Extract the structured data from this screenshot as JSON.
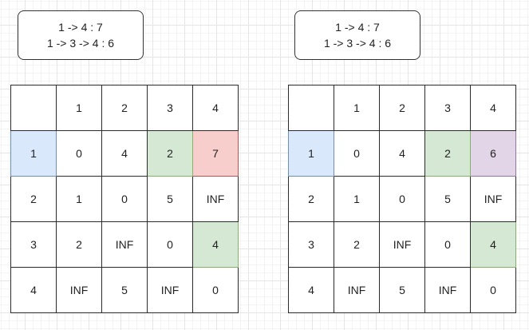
{
  "left": {
    "note": [
      "1 -> 4 : 7",
      "1 -> 3 -> 4 : 6"
    ],
    "rows": [
      [
        "",
        "1",
        "2",
        "3",
        "4"
      ],
      [
        "1",
        "0",
        "4",
        "2",
        "7"
      ],
      [
        "2",
        "1",
        "0",
        "5",
        "INF"
      ],
      [
        "3",
        "2",
        "INF",
        "0",
        "4"
      ],
      [
        "4",
        "INF",
        "5",
        "INF",
        "0"
      ]
    ]
  },
  "right": {
    "note": [
      "1 -> 4 : 7",
      "1 -> 3 -> 4 : 6"
    ],
    "rows": [
      [
        "",
        "1",
        "2",
        "3",
        "4"
      ],
      [
        "1",
        "0",
        "4",
        "2",
        "6"
      ],
      [
        "2",
        "1",
        "0",
        "5",
        "INF"
      ],
      [
        "3",
        "2",
        "INF",
        "0",
        "4"
      ],
      [
        "4",
        "INF",
        "5",
        "INF",
        "0"
      ]
    ]
  },
  "colors": {
    "blue": "#dae8fc",
    "green": "#d5e8d4",
    "red": "#f8cecc",
    "purple": "#e1d5e7"
  }
}
